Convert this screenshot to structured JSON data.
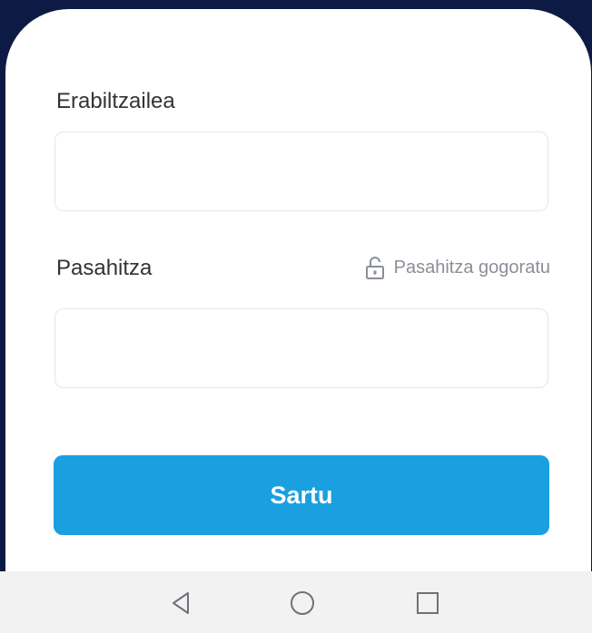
{
  "form": {
    "username_label": "Erabiltzailea",
    "username_value": "",
    "password_label": "Pasahitza",
    "password_value": "",
    "remember_label": "Pasahitza gogoratu",
    "remember_icon": "lock-icon",
    "submit_label": "Sartu"
  },
  "navbar": {
    "back_icon": "back-triangle-icon",
    "home_icon": "home-circle-icon",
    "recents_icon": "recents-square-icon"
  },
  "colors": {
    "header_bg": "#0d1b44",
    "accent": "#1a9fe0",
    "navbar_bg": "#f2f2f2"
  }
}
